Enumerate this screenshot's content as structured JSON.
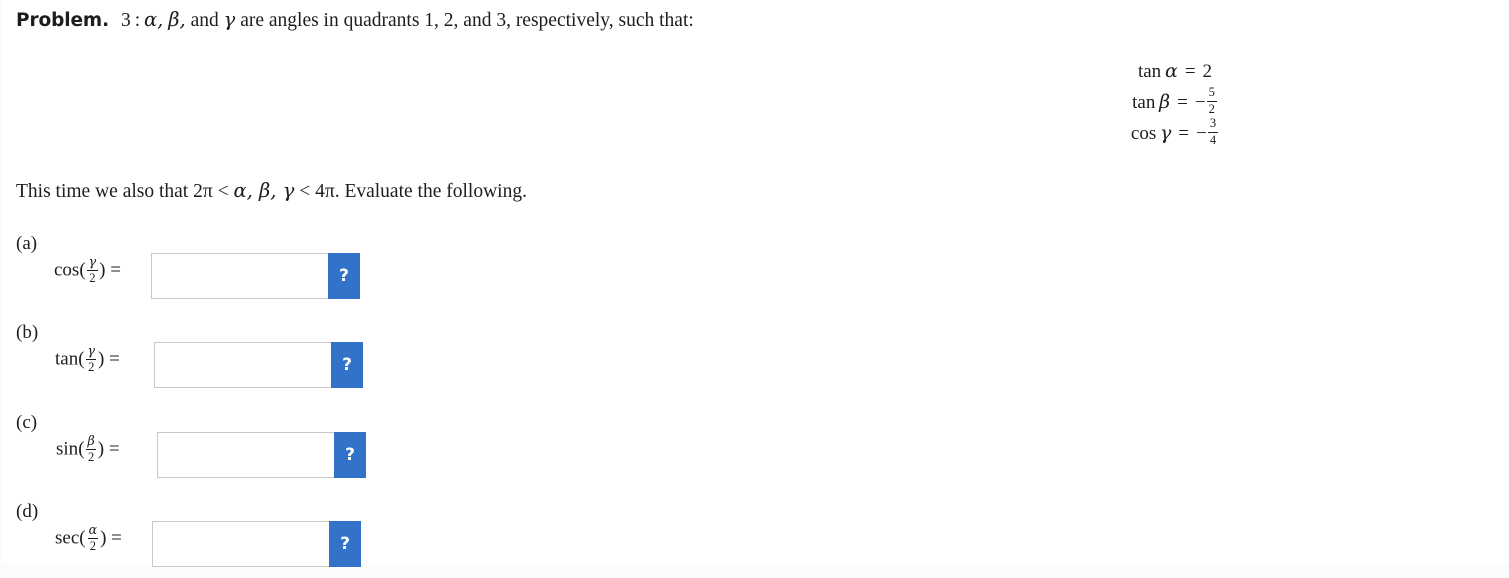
{
  "problem": {
    "label": "Problem.",
    "number": "3",
    "colon": ":",
    "statement_alpha": "α,",
    "statement_beta": "β,",
    "statement_and": "and",
    "statement_gamma": "γ",
    "statement_tail": "are angles in quadrants 1, 2, and 3, respectively, such that:"
  },
  "givens": [
    {
      "function": "tan",
      "variable": "α",
      "equals": "=",
      "value_kind": "integer",
      "sign": "",
      "value": "2",
      "numerator": "",
      "denominator": ""
    },
    {
      "function": "tan",
      "variable": "β",
      "equals": "=",
      "value_kind": "fraction",
      "sign": "−",
      "value": "-5/2",
      "numerator": "5",
      "denominator": "2"
    },
    {
      "function": "cos",
      "variable": "γ",
      "equals": "=",
      "value_kind": "fraction",
      "sign": "−",
      "value": "-3/4",
      "numerator": "3",
      "denominator": "4"
    }
  ],
  "condition": {
    "lead": "This time we also that",
    "lower_bound": "2π",
    "lt1": "<",
    "vars": "α, β, γ",
    "lt2": "<",
    "upper_bound": "4π",
    "period": ".",
    "tail": "Evaluate the following."
  },
  "answers": [
    {
      "tag": "(a)",
      "function": "cos",
      "arg_numerator": "γ",
      "arg_denominator": "2",
      "equals": "=",
      "input_value": "",
      "input_placeholder": "",
      "hint_label": "?"
    },
    {
      "tag": "(b)",
      "function": "tan",
      "arg_numerator": "γ",
      "arg_denominator": "2",
      "equals": "=",
      "input_value": "",
      "input_placeholder": "",
      "hint_label": "?"
    },
    {
      "tag": "(c)",
      "function": "sin",
      "arg_numerator": "β",
      "arg_denominator": "2",
      "equals": "=",
      "input_value": "",
      "input_placeholder": "",
      "hint_label": "?"
    },
    {
      "tag": "(d)",
      "function": "sec",
      "arg_numerator": "α",
      "arg_denominator": "2",
      "equals": "=",
      "input_value": "",
      "input_placeholder": "",
      "hint_label": "?"
    }
  ],
  "colors": {
    "hint_button": "#3272c8",
    "input_border": "#c8c8c8",
    "page_background": "#ffffff",
    "text": "#1d1d1f"
  }
}
